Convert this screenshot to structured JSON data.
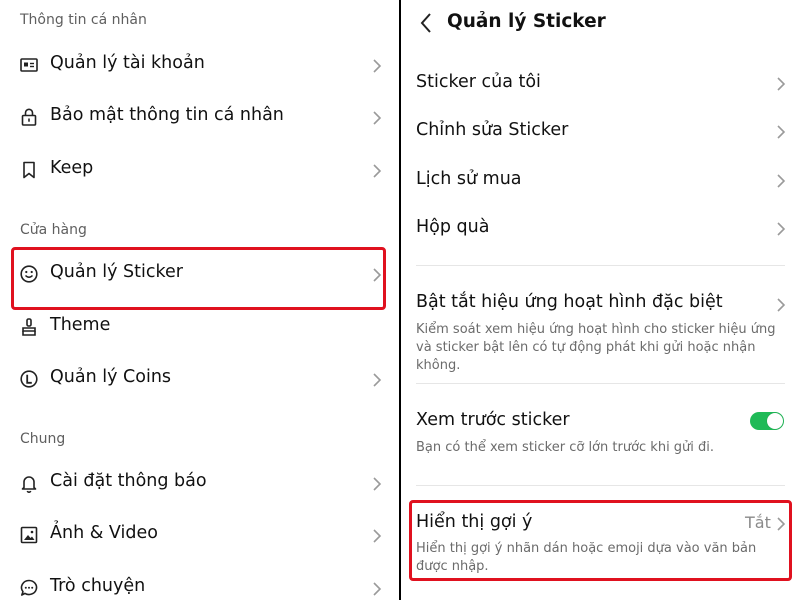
{
  "left_panel": {
    "sections": [
      {
        "title": "Thông tin cá nhân"
      },
      {
        "title": "Cửa hàng"
      },
      {
        "title": "Chung"
      }
    ],
    "items": [
      {
        "label": "Quản lý tài khoản",
        "icon": "id-card-icon"
      },
      {
        "label": "Bảo mật thông tin cá nhân",
        "icon": "lock-icon"
      },
      {
        "label": "Keep",
        "icon": "bookmark-icon"
      },
      {
        "label": "Quản lý Sticker",
        "icon": "smiley-icon"
      },
      {
        "label": "Theme",
        "icon": "paint-brush-icon"
      },
      {
        "label": "Quản lý Coins",
        "icon": "coin-icon"
      },
      {
        "label": "Cài đặt thông báo",
        "icon": "bell-icon"
      },
      {
        "label": "Ảnh & Video",
        "icon": "image-icon"
      },
      {
        "label": "Trò chuyện",
        "icon": "chat-icon"
      }
    ]
  },
  "right_panel": {
    "header": {
      "title": "Quản lý Sticker"
    },
    "items": [
      {
        "label": "Sticker của tôi"
      },
      {
        "label": "Chỉnh sửa Sticker"
      },
      {
        "label": "Lịch sử mua"
      },
      {
        "label": "Hộp quà"
      }
    ],
    "animation_setting": {
      "label": "Bật tắt hiệu ứng hoạt hình đặc biệt",
      "description": "Kiểm soát xem hiệu ứng hoạt hình cho sticker hiệu ứng và sticker bật lên có tự động phát khi gửi hoặc nhận không."
    },
    "preview_setting": {
      "label": "Xem trước sticker",
      "description": "Bạn có thể xem sticker cỡ lớn trước khi gửi đi.",
      "enabled": true
    },
    "suggestion_setting": {
      "label": "Hiển thị gợi ý",
      "value": "Tắt",
      "description": "Hiển thị gợi ý nhãn dán hoặc emoji dựa vào văn bản được nhập."
    }
  },
  "colors": {
    "highlight": "#e0111f",
    "toggle_on": "#1fba57"
  }
}
